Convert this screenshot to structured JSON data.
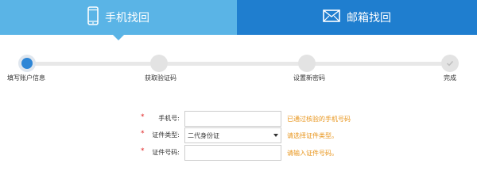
{
  "tabs": {
    "phone_label": "手机找回",
    "email_label": "邮箱找回"
  },
  "steps": [
    {
      "label": "填写账户信息",
      "state": "active"
    },
    {
      "label": "获取验证码",
      "state": "pending"
    },
    {
      "label": "设置新密码",
      "state": "pending"
    },
    {
      "label": "完成",
      "state": "done"
    }
  ],
  "form": {
    "phone": {
      "required": "*",
      "label": "手机号:",
      "value": "",
      "hint": "已通过核验的手机号码"
    },
    "id_type": {
      "required": "*",
      "label": "证件类型:",
      "value": "二代身份证",
      "hint": "请选择证件类型。"
    },
    "id_number": {
      "required": "*",
      "label": "证件号码:",
      "value": "",
      "hint": "请输入证件号码。"
    }
  },
  "colors": {
    "tab_active": "#5ab4e6",
    "tab_inactive": "#1f7ecf",
    "step_active": "#2e86d6",
    "hint": "#e8941a",
    "required": "#e02020"
  }
}
